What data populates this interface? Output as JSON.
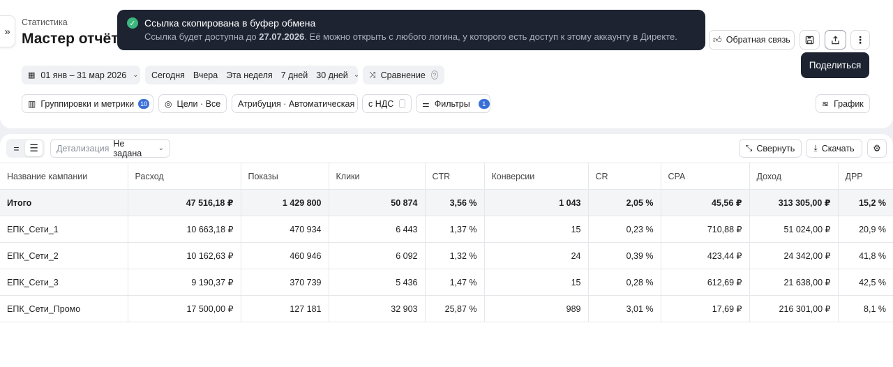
{
  "header": {
    "breadcrumb": "Статистика",
    "title": "Мастер отчётов",
    "feedback_label": "Обратная связь",
    "share_tooltip": "Поделиться"
  },
  "toast": {
    "title": "Ссылка скопирована в буфер обмена",
    "text_before": "Ссылка будет доступна до ",
    "date": "27.07.2026",
    "text_after": ". Её можно открыть с любого логина, у которого есть доступ к этому аккаунту в Директе."
  },
  "filters": {
    "date_range": "01 янв – 31 мар 2026",
    "periods": [
      "Сегодня",
      "Вчера",
      "Эта неделя",
      "7 дней",
      "30 дней"
    ],
    "compare_label": "Сравнение",
    "groupings_label": "Группировки и метрики",
    "groupings_count": "10",
    "goals_label": "Цели · Все",
    "attribution_label": "Атрибуция · Автоматическая",
    "vat_label": "с НДС",
    "filters_label": "Фильтры",
    "filters_count": "1",
    "chart_label": "График"
  },
  "toolbar": {
    "detail_label": "Детализация",
    "detail_value": "Не задана",
    "collapse_label": "Свернуть",
    "download_label": "Скачать"
  },
  "table": {
    "columns": [
      "Название кампании",
      "Расход",
      "Показы",
      "Клики",
      "CTR",
      "Конверсии",
      "CR",
      "CPA",
      "Доход",
      "ДРР"
    ],
    "total": [
      "Итого",
      "47 516,18 ₽",
      "1 429 800",
      "50 874",
      "3,56 %",
      "1 043",
      "2,05 %",
      "45,56 ₽",
      "313 305,00 ₽",
      "15,2 %"
    ],
    "rows": [
      [
        "ЕПК_Сети_1",
        "10 663,18 ₽",
        "470 934",
        "6 443",
        "1,37 %",
        "15",
        "0,23 %",
        "710,88 ₽",
        "51 024,00 ₽",
        "20,9 %"
      ],
      [
        "ЕПК_Сети_2",
        "10 162,63 ₽",
        "460 946",
        "6 092",
        "1,32 %",
        "24",
        "0,39 %",
        "423,44 ₽",
        "24 342,00 ₽",
        "41,8 %"
      ],
      [
        "ЕПК_Сети_3",
        "9 190,37 ₽",
        "370 739",
        "5 436",
        "1,47 %",
        "15",
        "0,28 %",
        "612,69 ₽",
        "21 638,00 ₽",
        "42,5 %"
      ],
      [
        "ЕПК_Сети_Промо",
        "17 500,00 ₽",
        "127 181",
        "32 903",
        "25,87 %",
        "989",
        "3,01 %",
        "17,69 ₽",
        "216 301,00 ₽",
        "8,1 %"
      ]
    ]
  }
}
